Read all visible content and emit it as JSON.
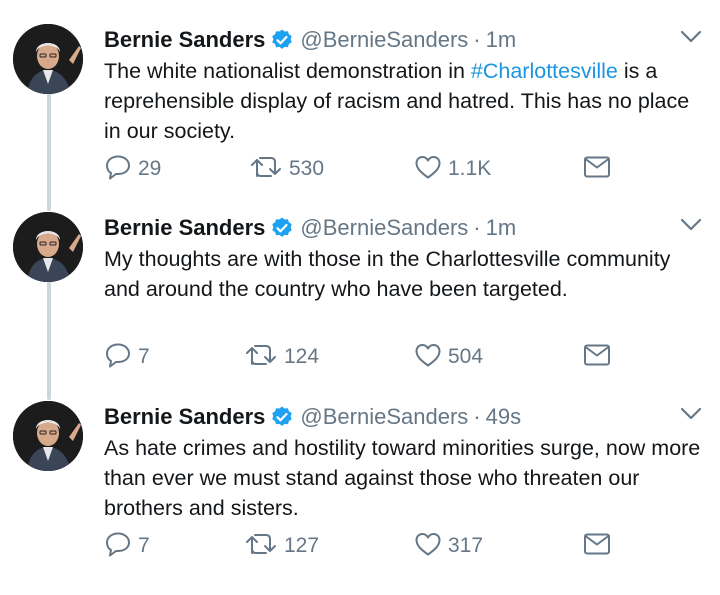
{
  "tweets": [
    {
      "name": "Bernie Sanders",
      "handle": "@BernieSanders",
      "separator": "·",
      "time": "1m",
      "text_before": "The white nationalist demonstration in ",
      "hashtag": "#Charlottesville",
      "text_after": " is a reprehensible display of racism and hatred. This has no place in our society.",
      "replies": "29",
      "retweets": "530",
      "likes": "1.1K"
    },
    {
      "name": "Bernie Sanders",
      "handle": "@BernieSanders",
      "separator": "·",
      "time": "1m",
      "text_before": "My thoughts are with those in the Charlottesville community and around the country who have been targeted.",
      "hashtag": "",
      "text_after": "",
      "replies": "7",
      "retweets": "124",
      "likes": "504"
    },
    {
      "name": "Bernie Sanders",
      "handle": "@BernieSanders",
      "separator": "·",
      "time": "49s",
      "text_before": "As hate crimes and hostility toward minorities surge, now more than ever we must stand against those who threaten our brothers and sisters.",
      "hashtag": "",
      "text_after": "",
      "replies": "7",
      "retweets": "127",
      "likes": "317"
    }
  ],
  "colors": {
    "text": "#14171a",
    "muted": "#657786",
    "link": "#1b95e0",
    "verified": "#1da1f2",
    "thread_line": "#ccd6dd"
  },
  "icons": [
    "verified-badge-icon",
    "chevron-down-icon",
    "reply-icon",
    "retweet-icon",
    "like-icon",
    "direct-message-icon"
  ]
}
